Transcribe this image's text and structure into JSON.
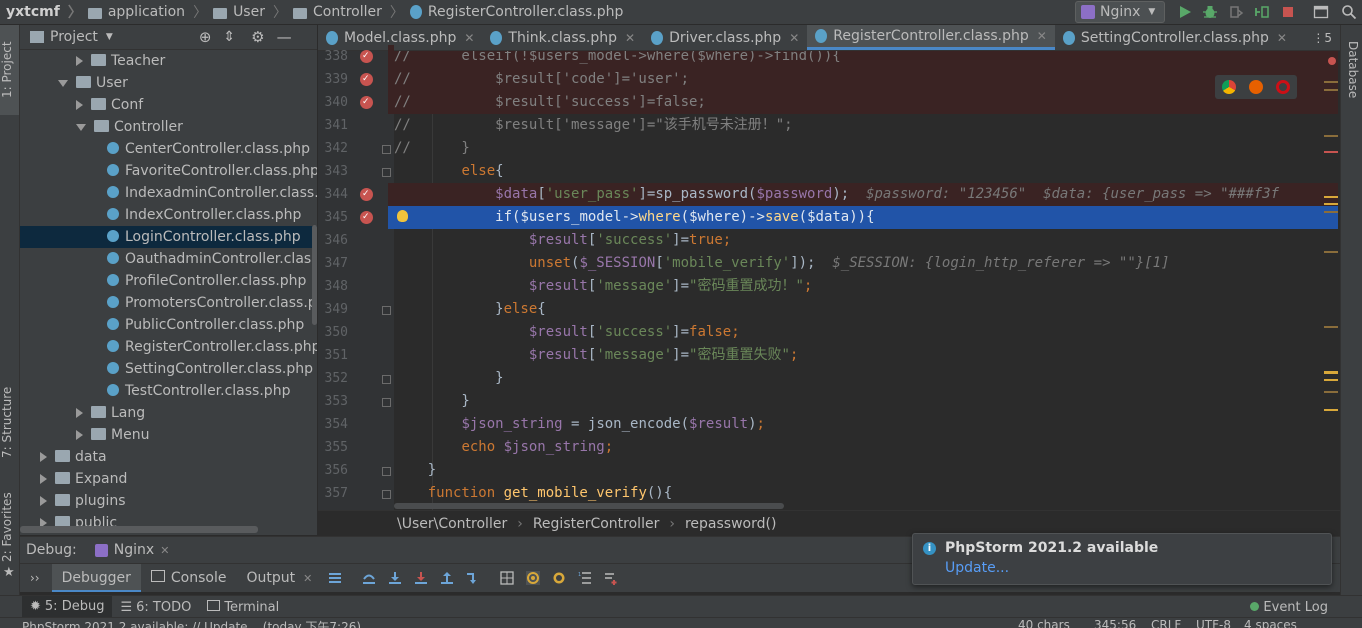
{
  "breadcrumbs": [
    "yxtcmf",
    "application",
    "User",
    "Controller",
    "RegisterController.class.php"
  ],
  "run_config": "Nginx",
  "left_strip": {
    "project": "1: Project",
    "structure": "7: Structure",
    "favorites": "2: Favorites"
  },
  "right_strip": {
    "database": "Database"
  },
  "project_panel": {
    "title": "Project",
    "tree": [
      {
        "label": "Teacher",
        "type": "folder",
        "state": "collapsed",
        "depth": 4
      },
      {
        "label": "User",
        "type": "folder",
        "state": "expanded",
        "depth": 3
      },
      {
        "label": "Conf",
        "type": "folder",
        "state": "collapsed",
        "depth": 4
      },
      {
        "label": "Controller",
        "type": "folder",
        "state": "expanded",
        "depth": 4
      },
      {
        "label": "CenterController.class.php",
        "type": "file",
        "depth": 5
      },
      {
        "label": "FavoriteController.class.php",
        "type": "file",
        "depth": 5
      },
      {
        "label": "IndexadminController.class.php",
        "type": "file",
        "depth": 5
      },
      {
        "label": "IndexController.class.php",
        "type": "file",
        "depth": 5
      },
      {
        "label": "LoginController.class.php",
        "type": "file",
        "depth": 5,
        "selected": true
      },
      {
        "label": "OauthadminController.class.php",
        "type": "file",
        "depth": 5
      },
      {
        "label": "ProfileController.class.php",
        "type": "file",
        "depth": 5
      },
      {
        "label": "PromotersController.class.php",
        "type": "file",
        "depth": 5
      },
      {
        "label": "PublicController.class.php",
        "type": "file",
        "depth": 5
      },
      {
        "label": "RegisterController.class.php",
        "type": "file",
        "depth": 5
      },
      {
        "label": "SettingController.class.php",
        "type": "file",
        "depth": 5
      },
      {
        "label": "TestController.class.php",
        "type": "file",
        "depth": 5
      },
      {
        "label": "Lang",
        "type": "folder",
        "state": "collapsed",
        "depth": 4
      },
      {
        "label": "Menu",
        "type": "folder",
        "state": "collapsed",
        "depth": 4
      },
      {
        "label": "data",
        "type": "folder",
        "state": "collapsed",
        "depth": 2
      },
      {
        "label": "Expand",
        "type": "folder",
        "state": "collapsed",
        "depth": 2
      },
      {
        "label": "plugins",
        "type": "folder",
        "state": "collapsed",
        "depth": 2
      },
      {
        "label": "public",
        "type": "folder",
        "state": "collapsed",
        "depth": 2
      }
    ]
  },
  "editor_tabs": [
    {
      "label": "Model.class.php",
      "active": false
    },
    {
      "label": "Think.class.php",
      "active": false
    },
    {
      "label": "Driver.class.php",
      "active": false
    },
    {
      "label": "RegisterController.class.php",
      "active": true
    },
    {
      "label": "SettingController.class.php",
      "active": false
    }
  ],
  "tabs_overflow": "5",
  "code_lines": [
    {
      "n": "338",
      "bp": true,
      "style": "bp",
      "tokens": [
        [
          "cm",
          "//      elseif(!$users_model->where($where)->find()){"
        ]
      ]
    },
    {
      "n": "339",
      "bp": true,
      "style": "bp",
      "tokens": [
        [
          "cm",
          "//          $result['code']='user';"
        ]
      ]
    },
    {
      "n": "340",
      "bp": true,
      "style": "bp",
      "tokens": [
        [
          "cm",
          "//          $result['success']=false;"
        ]
      ]
    },
    {
      "n": "341",
      "bp": false,
      "style": "",
      "tokens": [
        [
          "cm",
          "//          $result['message']=\"该手机号未注册！\";"
        ]
      ]
    },
    {
      "n": "342",
      "bp": false,
      "style": "",
      "tokens": [
        [
          "cm",
          "//      }"
        ]
      ]
    },
    {
      "n": "343",
      "bp": false,
      "style": "",
      "tokens": [
        [
          "wf",
          "        "
        ],
        [
          "kw",
          "else"
        ],
        [
          "wf",
          "{"
        ]
      ]
    },
    {
      "n": "344",
      "bp": true,
      "style": "bp",
      "tokens": [
        [
          "wf",
          "            "
        ],
        [
          "var",
          "$data"
        ],
        [
          "wf",
          "["
        ],
        [
          "str",
          "'user_pass'"
        ],
        [
          "wf",
          "]="
        ],
        [
          "wf",
          "sp_password("
        ],
        [
          "var",
          "$password"
        ],
        [
          "wf",
          ");  "
        ],
        [
          "hint",
          "$password: \"123456\"  $data: {user_pass => \"###f3f"
        ]
      ]
    },
    {
      "n": "345",
      "bp": true,
      "style": "cur",
      "tokens": [
        [
          "wf",
          "            "
        ],
        [
          "kw",
          "if"
        ],
        [
          "wf",
          "("
        ],
        [
          "var",
          "$users_model"
        ],
        [
          "wf",
          "->"
        ],
        [
          "fn",
          "where"
        ],
        [
          "wf",
          "("
        ],
        [
          "var",
          "$where"
        ],
        [
          "wf",
          ")->"
        ],
        [
          "fn",
          "save"
        ],
        [
          "wf",
          "("
        ],
        [
          "var",
          "$data"
        ],
        [
          "wf",
          ")){"
        ]
      ]
    },
    {
      "n": "346",
      "bp": false,
      "style": "",
      "tokens": [
        [
          "wf",
          "                "
        ],
        [
          "var",
          "$result"
        ],
        [
          "wf",
          "["
        ],
        [
          "str",
          "'success'"
        ],
        [
          "wf",
          "]="
        ],
        [
          "kw",
          "true"
        ],
        [
          "kw",
          ";"
        ]
      ]
    },
    {
      "n": "347",
      "bp": false,
      "style": "",
      "tokens": [
        [
          "wf",
          "                "
        ],
        [
          "kw",
          "unset"
        ],
        [
          "wf",
          "("
        ],
        [
          "var",
          "$_SESSION"
        ],
        [
          "wf",
          "["
        ],
        [
          "str",
          "'mobile_verify'"
        ],
        [
          "wf",
          "]);  "
        ],
        [
          "hint",
          "$_SESSION: {login_http_referer => \"\"}[1]"
        ]
      ]
    },
    {
      "n": "348",
      "bp": false,
      "style": "",
      "tokens": [
        [
          "wf",
          "                "
        ],
        [
          "var",
          "$result"
        ],
        [
          "wf",
          "["
        ],
        [
          "str",
          "'message'"
        ],
        [
          "wf",
          "]="
        ],
        [
          "str",
          "\"密码重置成功！\""
        ],
        [
          "kw",
          ";"
        ]
      ]
    },
    {
      "n": "349",
      "bp": false,
      "style": "",
      "tokens": [
        [
          "wf",
          "            }"
        ],
        [
          "kw",
          "else"
        ],
        [
          "wf",
          "{"
        ]
      ]
    },
    {
      "n": "350",
      "bp": false,
      "style": "",
      "tokens": [
        [
          "wf",
          "                "
        ],
        [
          "var",
          "$result"
        ],
        [
          "wf",
          "["
        ],
        [
          "str",
          "'success'"
        ],
        [
          "wf",
          "]="
        ],
        [
          "kw",
          "false"
        ],
        [
          "kw",
          ";"
        ]
      ]
    },
    {
      "n": "351",
      "bp": false,
      "style": "",
      "tokens": [
        [
          "wf",
          "                "
        ],
        [
          "var",
          "$result"
        ],
        [
          "wf",
          "["
        ],
        [
          "str",
          "'message'"
        ],
        [
          "wf",
          "]="
        ],
        [
          "str",
          "\"密码重置失败\""
        ],
        [
          "kw",
          ";"
        ]
      ]
    },
    {
      "n": "352",
      "bp": false,
      "style": "",
      "tokens": [
        [
          "wf",
          "            }"
        ]
      ]
    },
    {
      "n": "353",
      "bp": false,
      "style": "",
      "tokens": [
        [
          "wf",
          "        }"
        ]
      ]
    },
    {
      "n": "354",
      "bp": false,
      "style": "",
      "tokens": [
        [
          "wf",
          "        "
        ],
        [
          "var",
          "$json_string"
        ],
        [
          "wf",
          " = "
        ],
        [
          "wf",
          "json_encode("
        ],
        [
          "var",
          "$result"
        ],
        [
          "wf",
          ")"
        ],
        [
          "kw",
          ";"
        ]
      ]
    },
    {
      "n": "355",
      "bp": false,
      "style": "",
      "tokens": [
        [
          "wf",
          "        "
        ],
        [
          "kw",
          "echo "
        ],
        [
          "var",
          "$json_string"
        ],
        [
          "kw",
          ";"
        ]
      ]
    },
    {
      "n": "356",
      "bp": false,
      "style": "",
      "tokens": [
        [
          "wf",
          "    }"
        ]
      ]
    },
    {
      "n": "357",
      "bp": false,
      "style": "",
      "tokens": [
        [
          "wf",
          "    "
        ],
        [
          "kw",
          "function "
        ],
        [
          "fn",
          "get_mobile_verify"
        ],
        [
          "wf",
          "(){"
        ]
      ]
    }
  ],
  "editor_breadcrumb": [
    "\\User\\Controller",
    "RegisterController",
    "repassword()"
  ],
  "debug": {
    "label": "Debug:",
    "session": "Nginx",
    "tabs": [
      "Debugger",
      "Console",
      "Output"
    ]
  },
  "bottom_tabs": [
    {
      "label": "5: Debug",
      "active": true
    },
    {
      "label": "6: TODO",
      "active": false
    },
    {
      "label": "Terminal",
      "active": false
    }
  ],
  "event_log": "Event Log",
  "notification": {
    "title": "PhpStorm 2021.2 available",
    "link": "Update..."
  },
  "status": {
    "message": "PhpStorm 2021.2 available: // Update... (today 下午7:26)",
    "chars": "40 chars",
    "position": "345:56",
    "line_sep": "CRLF",
    "encoding": "UTF-8",
    "indent": "4 spaces"
  },
  "colors": {
    "accent": "#4a88c7",
    "breakpoint": "#c75450",
    "current_line": "#2154a8",
    "selection": "#0d293e"
  }
}
